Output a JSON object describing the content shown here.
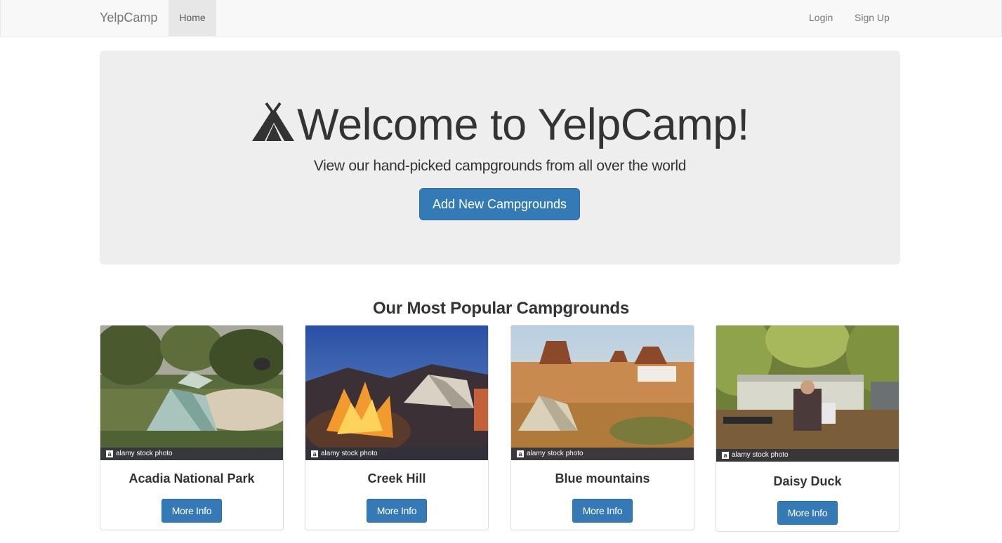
{
  "navbar": {
    "brand": "YelpCamp",
    "home": "Home",
    "login": "Login",
    "signup": "Sign Up"
  },
  "jumbotron": {
    "icon": "tent-icon",
    "title": "Welcome to YelpCamp!",
    "subtitle": "View our hand-picked campgrounds from all over the world",
    "button": "Add New Campgrounds"
  },
  "section": {
    "title": "Our Most Popular Campgrounds"
  },
  "campgrounds": [
    {
      "name": "Acadia National Park",
      "button": "More Info",
      "watermark": "alamy stock photo"
    },
    {
      "name": "Creek Hill",
      "button": "More Info",
      "watermark": "alamy stock photo"
    },
    {
      "name": "Blue mountains",
      "button": "More Info",
      "watermark": "alamy stock photo"
    },
    {
      "name": "Daisy Duck",
      "button": "More Info",
      "watermark": "alamy stock photo"
    }
  ],
  "colors": {
    "primary": "#337ab7",
    "navbar_bg": "#f8f8f8",
    "jumbotron_bg": "#eeeeee"
  }
}
